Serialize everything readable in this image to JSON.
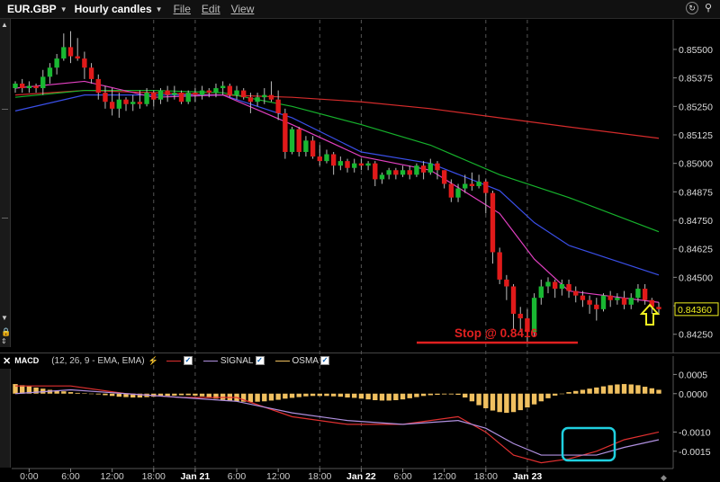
{
  "toolbar": {
    "symbol": "EUR.GBP",
    "timeframe": "Hourly candles",
    "menu": [
      "File",
      "Edit",
      "View"
    ]
  },
  "colors": {
    "up_candle": "#19b832",
    "down_candle": "#e01a1a",
    "ma_red": "#d42b2b",
    "ma_green": "#16b22c",
    "ma_blue": "#3a4fe8",
    "ma_magenta": "#e040c0",
    "macd_line": "#e03030",
    "signal_line": "#b090e0",
    "osma_bar": "#f0c060",
    "highlight_box": "#20d0e0",
    "annotation_arrow": "#f0f020",
    "stop_text": "#e02020"
  },
  "macd_header": {
    "name": "MACD",
    "params": "(12, 26, 9 - EMA, EMA)",
    "series": [
      "SIGNAL",
      "OSMA"
    ]
  },
  "annotations": {
    "stop_label": "Stop @ 0.8416",
    "last_price_label": "0.84360"
  },
  "chart_data": [
    {
      "type": "candlestick",
      "title": "",
      "xlabel": "",
      "ylabel": "",
      "ylim": [
        0.8417,
        0.8563
      ],
      "grid": false,
      "y_ticks": [
        "0.85500",
        "0.85375",
        "0.85250",
        "0.85125",
        "0.85000",
        "0.84875",
        "0.84750",
        "0.84625",
        "0.84500",
        "0.84375",
        "0.84250"
      ],
      "x_ticks": [
        "0:00",
        "6:00",
        "12:00",
        "18:00",
        "Jan 21",
        "6:00",
        "12:00",
        "18:00",
        "Jan 22",
        "6:00",
        "12:00",
        "18:00",
        "Jan 23"
      ],
      "last_price": 0.8436,
      "stop_level": 0.8416,
      "candles": [
        [
          0.8533,
          0.8535,
          0.8536,
          0.8531
        ],
        [
          0.8535,
          0.8533,
          0.8537,
          0.8531
        ],
        [
          0.8533,
          0.8534,
          0.8536,
          0.8531
        ],
        [
          0.8534,
          0.8533,
          0.8535,
          0.8531
        ],
        [
          0.8533,
          0.8538,
          0.8541,
          0.853
        ],
        [
          0.8538,
          0.8542,
          0.8544,
          0.8535
        ],
        [
          0.8542,
          0.8546,
          0.8548,
          0.8539
        ],
        [
          0.8546,
          0.8551,
          0.8557,
          0.8545
        ],
        [
          0.8551,
          0.8547,
          0.8558,
          0.8544
        ],
        [
          0.8547,
          0.8546,
          0.8555,
          0.8545
        ],
        [
          0.8546,
          0.8542,
          0.8549,
          0.8537
        ],
        [
          0.8542,
          0.8537,
          0.8544,
          0.8535
        ],
        [
          0.8537,
          0.8531,
          0.8539,
          0.8528
        ],
        [
          0.8531,
          0.8527,
          0.8534,
          0.8524
        ],
        [
          0.8527,
          0.8524,
          0.8533,
          0.8521
        ],
        [
          0.8524,
          0.8528,
          0.8531,
          0.852
        ],
        [
          0.8528,
          0.8526,
          0.8529,
          0.8523
        ],
        [
          0.8526,
          0.8527,
          0.853,
          0.8523
        ],
        [
          0.8527,
          0.8526,
          0.8532,
          0.8524
        ],
        [
          0.8526,
          0.8531,
          0.8533,
          0.8525
        ],
        [
          0.8531,
          0.8528,
          0.8532,
          0.8525
        ],
        [
          0.8528,
          0.8532,
          0.8533,
          0.8526
        ],
        [
          0.8532,
          0.853,
          0.8534,
          0.8527
        ],
        [
          0.853,
          0.8531,
          0.8534,
          0.8528
        ],
        [
          0.8531,
          0.8527,
          0.8532,
          0.8526
        ],
        [
          0.8527,
          0.8531,
          0.8532,
          0.8526
        ],
        [
          0.8531,
          0.853,
          0.8533,
          0.8527
        ],
        [
          0.853,
          0.8532,
          0.8534,
          0.8528
        ],
        [
          0.8532,
          0.8531,
          0.8533,
          0.8529
        ],
        [
          0.8531,
          0.8533,
          0.8535,
          0.8529
        ],
        [
          0.8533,
          0.8534,
          0.8536,
          0.853
        ],
        [
          0.8534,
          0.853,
          0.8535,
          0.8529
        ],
        [
          0.853,
          0.8532,
          0.8534,
          0.8528
        ],
        [
          0.8532,
          0.8529,
          0.8533,
          0.8528
        ],
        [
          0.8529,
          0.8527,
          0.8531,
          0.8522
        ],
        [
          0.8527,
          0.8529,
          0.8531,
          0.8525
        ],
        [
          0.8529,
          0.853,
          0.8533,
          0.8526
        ],
        [
          0.853,
          0.8528,
          0.8536,
          0.8527
        ],
        [
          0.8528,
          0.8522,
          0.8532,
          0.8519
        ],
        [
          0.8522,
          0.8505,
          0.8524,
          0.8502
        ],
        [
          0.8505,
          0.8515,
          0.8516,
          0.8504
        ],
        [
          0.8515,
          0.8505,
          0.8516,
          0.8503
        ],
        [
          0.8505,
          0.851,
          0.8512,
          0.8503
        ],
        [
          0.851,
          0.8503,
          0.8512,
          0.8502
        ],
        [
          0.8503,
          0.8501,
          0.8508,
          0.8499
        ],
        [
          0.8501,
          0.8504,
          0.8506,
          0.85
        ],
        [
          0.8504,
          0.8499,
          0.8505,
          0.8495
        ],
        [
          0.8499,
          0.8501,
          0.8503,
          0.8497
        ],
        [
          0.8501,
          0.8498,
          0.8502,
          0.8496
        ],
        [
          0.8498,
          0.85,
          0.8502,
          0.8496
        ],
        [
          0.85,
          0.8499,
          0.8502,
          0.8497
        ],
        [
          0.8499,
          0.85,
          0.8501,
          0.8497
        ],
        [
          0.85,
          0.8493,
          0.8501,
          0.849
        ],
        [
          0.8493,
          0.8495,
          0.8496,
          0.8491
        ],
        [
          0.8495,
          0.8497,
          0.8498,
          0.8493
        ],
        [
          0.8497,
          0.8495,
          0.8498,
          0.8493
        ],
        [
          0.8495,
          0.8497,
          0.8499,
          0.8494
        ],
        [
          0.8497,
          0.8495,
          0.8499,
          0.8493
        ],
        [
          0.8495,
          0.8499,
          0.85,
          0.8494
        ],
        [
          0.8499,
          0.8496,
          0.8501,
          0.8493
        ],
        [
          0.8496,
          0.85,
          0.8502,
          0.8495
        ],
        [
          0.85,
          0.8497,
          0.8501,
          0.8493
        ],
        [
          0.8497,
          0.8491,
          0.8497,
          0.8489
        ],
        [
          0.8491,
          0.8485,
          0.8493,
          0.8483
        ],
        [
          0.8485,
          0.8489,
          0.8491,
          0.8483
        ],
        [
          0.8489,
          0.8491,
          0.8495,
          0.8487
        ],
        [
          0.8491,
          0.849,
          0.8496,
          0.8488
        ],
        [
          0.849,
          0.8492,
          0.8495,
          0.8489
        ],
        [
          0.8492,
          0.8487,
          0.8493,
          0.8478
        ],
        [
          0.8487,
          0.8461,
          0.8488,
          0.8456
        ],
        [
          0.8461,
          0.8449,
          0.8463,
          0.8447
        ],
        [
          0.8449,
          0.8446,
          0.8451,
          0.844
        ],
        [
          0.8446,
          0.8434,
          0.8447,
          0.8427
        ],
        [
          0.8434,
          0.8432,
          0.8437,
          0.8426
        ],
        [
          0.8432,
          0.8426,
          0.8436,
          0.8421
        ],
        [
          0.8426,
          0.8441,
          0.8443,
          0.8424
        ],
        [
          0.8441,
          0.8446,
          0.8449,
          0.8438
        ],
        [
          0.8446,
          0.8448,
          0.845,
          0.8443
        ],
        [
          0.8448,
          0.8445,
          0.8449,
          0.8441
        ],
        [
          0.8445,
          0.8447,
          0.8449,
          0.8442
        ],
        [
          0.8447,
          0.8444,
          0.8449,
          0.8441
        ],
        [
          0.8444,
          0.8442,
          0.8446,
          0.8439
        ],
        [
          0.8442,
          0.844,
          0.8444,
          0.8437
        ],
        [
          0.844,
          0.8438,
          0.8442,
          0.8434
        ],
        [
          0.8438,
          0.8436,
          0.8441,
          0.8431
        ],
        [
          0.8436,
          0.8442,
          0.8443,
          0.8435
        ],
        [
          0.8442,
          0.844,
          0.8444,
          0.8437
        ],
        [
          0.844,
          0.8441,
          0.8443,
          0.8438
        ],
        [
          0.8441,
          0.8438,
          0.8444,
          0.8436
        ],
        [
          0.8438,
          0.8441,
          0.8443,
          0.8436
        ],
        [
          0.8441,
          0.8445,
          0.8447,
          0.8439
        ],
        [
          0.8445,
          0.844,
          0.8447,
          0.8438
        ],
        [
          0.844,
          0.8437,
          0.8441,
          0.8434
        ],
        [
          0.8437,
          0.8436,
          0.8439,
          0.8434
        ]
      ],
      "moving_averages": [
        {
          "color": "#d42b2b",
          "x": [
            0,
            10,
            20,
            30,
            40,
            50,
            60,
            70,
            80,
            93
          ],
          "values": [
            0.853,
            0.8532,
            0.8531,
            0.853,
            0.8529,
            0.8527,
            0.8524,
            0.852,
            0.8516,
            0.8511
          ]
        },
        {
          "color": "#16b22c",
          "x": [
            0,
            10,
            20,
            30,
            40,
            50,
            60,
            70,
            80,
            93
          ],
          "values": [
            0.8529,
            0.8532,
            0.8532,
            0.8531,
            0.8525,
            0.8517,
            0.8508,
            0.8495,
            0.8485,
            0.847
          ]
        },
        {
          "color": "#3a4fe8",
          "x": [
            0,
            10,
            20,
            30,
            40,
            50,
            60,
            70,
            75,
            80,
            93
          ],
          "values": [
            0.8523,
            0.853,
            0.853,
            0.853,
            0.852,
            0.8505,
            0.85,
            0.8488,
            0.8474,
            0.8464,
            0.8451
          ]
        },
        {
          "color": "#e040c0",
          "x": [
            0,
            10,
            20,
            30,
            40,
            50,
            60,
            70,
            75,
            80,
            93
          ],
          "values": [
            0.8533,
            0.8536,
            0.8529,
            0.853,
            0.8517,
            0.8503,
            0.8497,
            0.8478,
            0.8458,
            0.8444,
            0.8439
          ]
        }
      ]
    },
    {
      "type": "bar",
      "title": "MACD",
      "ylim": [
        -0.00195,
        0.00065
      ],
      "y_ticks": [
        "0.0005",
        "0.0000",
        "-0.0010",
        "-0.0015"
      ],
      "osma": [
        0.00025,
        0.00022,
        0.00019,
        0.00016,
        0.00013,
        0.0001,
        8e-05,
        6e-05,
        4e-05,
        2e-05,
        1e-05,
        0,
        -2e-05,
        -4e-05,
        -6e-05,
        -8e-05,
        -9e-05,
        -0.0001,
        -0.0001,
        -9e-05,
        -8e-05,
        -7e-05,
        -6e-05,
        -5e-05,
        -4e-05,
        -4e-05,
        -5e-05,
        -7e-05,
        -0.0001,
        -0.00013,
        -0.00016,
        -0.00018,
        -0.0002,
        -0.00021,
        -0.00022,
        -0.00021,
        -0.0002,
        -0.00018,
        -0.00016,
        -0.00013,
        -0.00011,
        -9e-05,
        -7e-05,
        -6e-05,
        -6e-05,
        -6e-05,
        -7e-05,
        -8e-05,
        -0.0001,
        -0.00011,
        -0.00013,
        -0.00015,
        -0.00017,
        -0.00018,
        -0.00018,
        -0.00017,
        -0.00015,
        -0.00012,
        -9e-05,
        -6e-05,
        -4e-05,
        -3e-05,
        -2e-05,
        -2e-05,
        -3e-05,
        -0.0001,
        -0.0002,
        -0.0003,
        -0.00038,
        -0.00044,
        -0.00048,
        -0.0005,
        -0.00048,
        -0.00043,
        -0.00036,
        -0.00028,
        -0.0002,
        -0.00012,
        -5e-05,
        0,
        4e-05,
        7e-05,
        0.0001,
        0.00013,
        0.00016,
        0.00019,
        0.00022,
        0.00024,
        0.00025,
        0.00024,
        0.00022,
        0.00018,
        0.00014,
        0.0001
      ],
      "lines": [
        {
          "name": "MACD",
          "color": "#e03030",
          "x": [
            0,
            8,
            16,
            24,
            32,
            40,
            48,
            56,
            64,
            68,
            72,
            76,
            80,
            84,
            88,
            93
          ],
          "values": [
            0.0002,
            0.0002,
            0.0,
            -0.0001,
            -0.0001,
            -0.0006,
            -0.0008,
            -0.0008,
            -0.0006,
            -0.001,
            -0.0016,
            -0.0018,
            -0.0017,
            -0.0015,
            -0.0012,
            -0.001
          ]
        },
        {
          "name": "SIGNAL",
          "color": "#b090e0",
          "x": [
            0,
            8,
            16,
            24,
            32,
            40,
            48,
            56,
            64,
            68,
            72,
            76,
            80,
            84,
            88,
            93
          ],
          "values": [
            0.0,
            0.0001,
            0.0,
            -0.0001,
            -0.0002,
            -0.0005,
            -0.0007,
            -0.0008,
            -0.0007,
            -0.0009,
            -0.0013,
            -0.0016,
            -0.0016,
            -0.0016,
            -0.0014,
            -0.0012
          ]
        }
      ]
    }
  ]
}
